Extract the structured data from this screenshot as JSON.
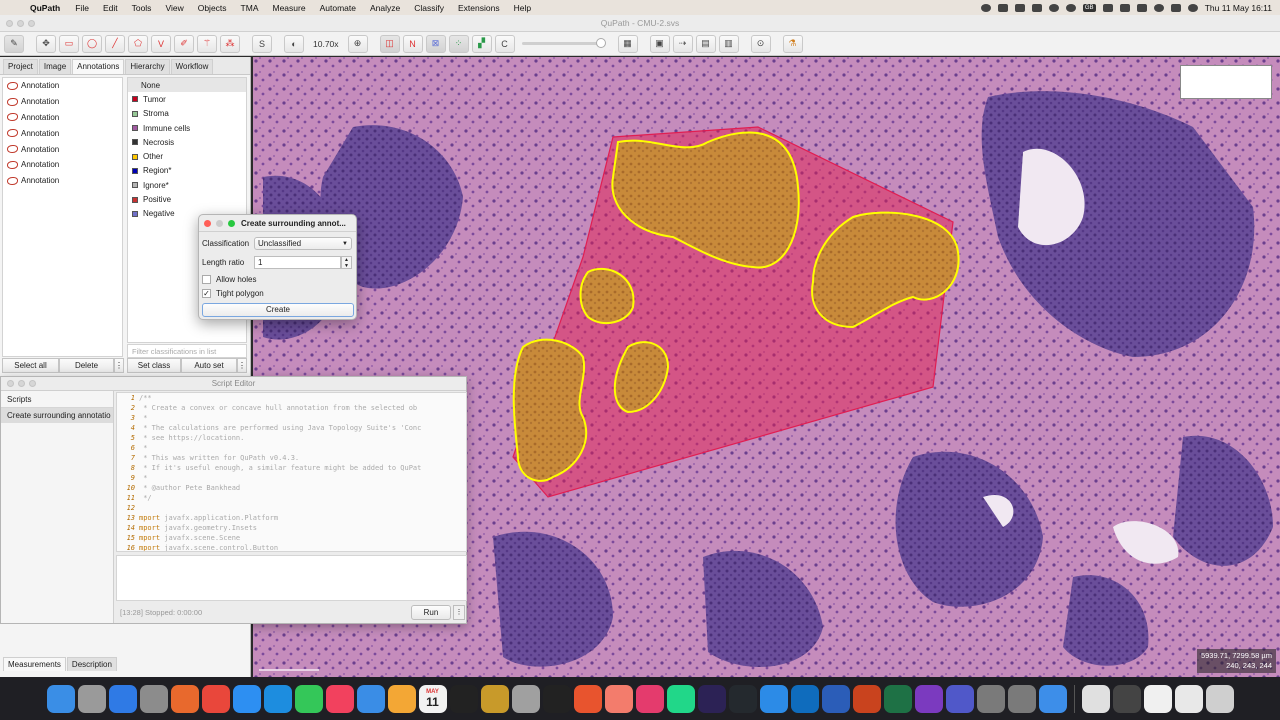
{
  "menubar": {
    "app_name": "QuPath",
    "items": [
      "File",
      "Edit",
      "Tools",
      "View",
      "Objects",
      "TMA",
      "Measure",
      "Automate",
      "Analyze",
      "Classify",
      "Extensions",
      "Help"
    ],
    "lang_badge": "GB",
    "datetime": "Thu 11 May  16:11"
  },
  "window": {
    "title": "QuPath - CMU-2.svs"
  },
  "toolbar": {
    "zoom": "10.70x",
    "tool_labels": {
      "spot": "V",
      "points": "S",
      "counting": "C",
      "annotations": "N"
    }
  },
  "left_panel": {
    "tabs": [
      "Project",
      "Image",
      "Annotations",
      "Hierarchy",
      "Workflow"
    ],
    "active_tab": "Annotations",
    "annotations": [
      "Annotation",
      "Annotation",
      "Annotation",
      "Annotation",
      "Annotation",
      "Annotation",
      "Annotation"
    ],
    "classes": [
      {
        "name": "None",
        "color": ""
      },
      {
        "name": "Tumor",
        "color": "#c8001e"
      },
      {
        "name": "Stroma",
        "color": "#96c896"
      },
      {
        "name": "Immune cells",
        "color": "#a05aa0"
      },
      {
        "name": "Necrosis",
        "color": "#323232"
      },
      {
        "name": "Other",
        "color": "#ffc800"
      },
      {
        "name": "Region*",
        "color": "#0000b4"
      },
      {
        "name": "Ignore*",
        "color": "#b4b4b4"
      },
      {
        "name": "Positive",
        "color": "#c83232"
      },
      {
        "name": "Negative",
        "color": "#7070c8"
      }
    ],
    "class_filter_placeholder": "Filter classifications in list",
    "buttons": {
      "select_all": "Select all",
      "delete": "Delete",
      "set_class": "Set class",
      "auto_set": "Auto set"
    }
  },
  "dialog": {
    "title": "Create surrounding annot...",
    "classification_label": "Classification",
    "classification_value": "Unclassified",
    "length_ratio_label": "Length ratio",
    "length_ratio_value": "1",
    "allow_holes_label": "Allow holes",
    "allow_holes_checked": false,
    "tight_polygon_label": "Tight polygon",
    "tight_polygon_checked": true,
    "create_button": "Create"
  },
  "script_editor": {
    "title": "Script Editor",
    "scripts_header": "Scripts",
    "script_item": "Create surrounding annotatio",
    "code_lines": [
      {
        "n": "1",
        "text": "/**",
        "kw": ""
      },
      {
        "n": "2",
        "text": " * Create a convex or concave hull annotation from the selected ob",
        "kw": ""
      },
      {
        "n": "3",
        "text": " *",
        "kw": ""
      },
      {
        "n": "4",
        "text": " * The calculations are performed using Java Topology Suite's 'Conc",
        "kw": ""
      },
      {
        "n": "5",
        "text": " * see https://locationn.",
        "kw": ""
      },
      {
        "n": "6",
        "text": " *",
        "kw": ""
      },
      {
        "n": "7",
        "text": " * This was written for QuPath v0.4.3.",
        "kw": ""
      },
      {
        "n": "8",
        "text": " * If it's useful enough, a similar feature might be added to QuPat",
        "kw": ""
      },
      {
        "n": "9",
        "text": " *",
        "kw": ""
      },
      {
        "n": "10",
        "text": " * @author Pete Bankhead",
        "kw": ""
      },
      {
        "n": "11",
        "text": " */",
        "kw": ""
      },
      {
        "n": "12",
        "text": "",
        "kw": ""
      },
      {
        "n": "13",
        "text": " javafx.application.Platform",
        "kw": "mport"
      },
      {
        "n": "14",
        "text": " javafx.geometry.Insets",
        "kw": "mport"
      },
      {
        "n": "15",
        "text": " javafx.scene.Scene",
        "kw": "mport"
      },
      {
        "n": "16",
        "text": " javafx.scene.control.Button",
        "kw": "mport"
      }
    ],
    "status": "[13:28]  Stopped: 0:00:00",
    "run_button": "Run"
  },
  "bottom_tabs": [
    "Measurements",
    "Description"
  ],
  "viewer": {
    "coordinates": "5939.71, 7299.58 µm",
    "rgb": "240, 243, 244"
  },
  "dock": {
    "calendar_month": "MAY",
    "calendar_day": "11",
    "icons": [
      "finder-icon",
      "launchpad-icon",
      "app-store-icon",
      "system-settings-icon",
      "firefox-icon",
      "chrome-icon",
      "safari-icon",
      "edge-icon",
      "messages-icon",
      "music-icon",
      "mail-icon",
      "photos-icon",
      "calendar-icon",
      "terminal-icon",
      "microscope-icon",
      "fiji-icon",
      "activity-monitor-icon",
      "scatter-app-icon",
      "clock-icon",
      "intellij-icon",
      "pycharm-icon",
      "eclipse-icon",
      "github-icon",
      "vscode-icon",
      "outlook-icon",
      "word-icon",
      "powerpoint-icon",
      "excel-icon",
      "onenote-icon",
      "teams-icon",
      "qupath-icon",
      "qupath-alt-icon",
      "xcode-icon",
      "preview-icon",
      "activity-icon",
      "documents-icon",
      "notes-icon",
      "trash-icon"
    ]
  }
}
